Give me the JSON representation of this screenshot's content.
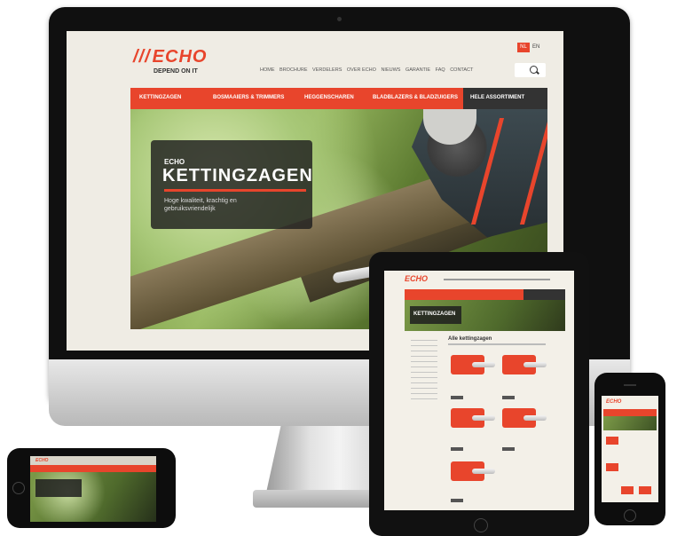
{
  "brand": {
    "logo_text": "ECHO",
    "tagline": "DEPEND ON IT",
    "color": "#e8452c"
  },
  "languages": {
    "active": "NL",
    "other": "EN"
  },
  "top_nav": [
    "HOME",
    "BROCHURE",
    "VERDELERS",
    "OVER ECHO",
    "NIEUWS",
    "GARANTIE",
    "FAQ",
    "CONTACT"
  ],
  "categories": [
    "KETTINGZAGEN",
    "BOSMAAIERS & TRIMMERS",
    "HEGGENSCHAREN",
    "BLADBLAZERS & BLADZUIGERS",
    "HELE ASSORTIMENT"
  ],
  "hero": {
    "brand": "ECHO",
    "title": "KETTINGZAGEN",
    "subtitle": "Hoge kwaliteit, krachtig en gebruiksvriendelijk"
  },
  "tablet": {
    "hero_title": "KETTINGZAGEN",
    "section_title": "Alle kettingzagen"
  },
  "icons": [
    "search-icon"
  ]
}
